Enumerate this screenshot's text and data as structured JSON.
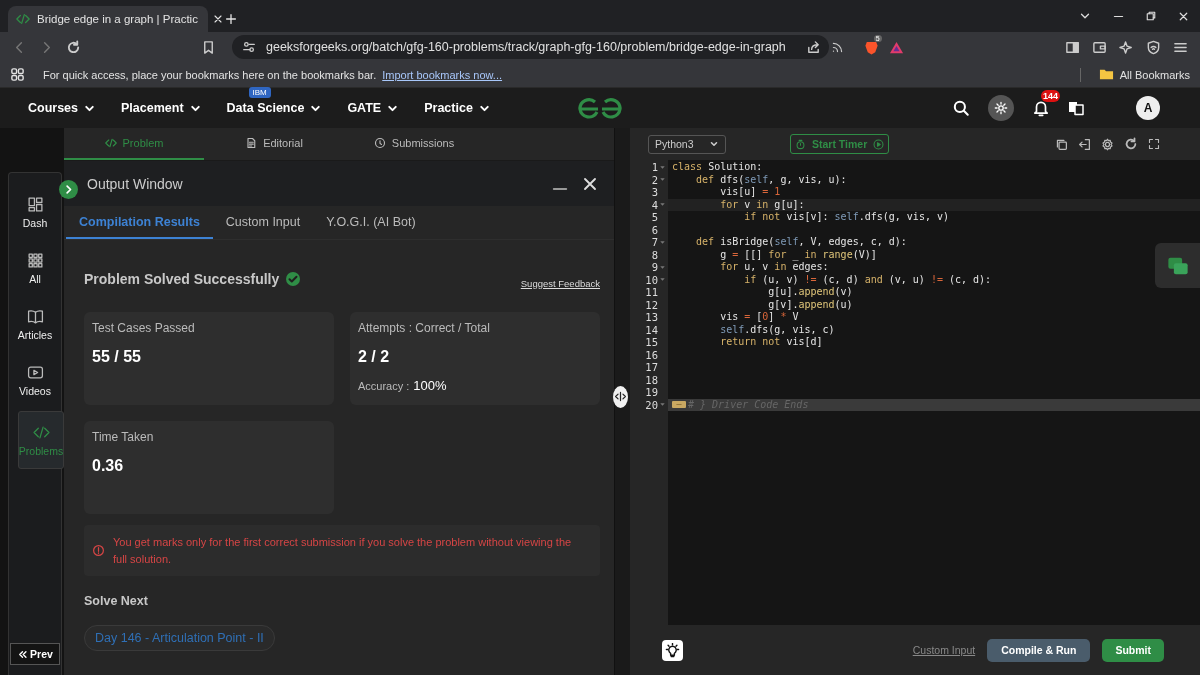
{
  "browser": {
    "tab_title": "Bridge edge in a graph | Practic",
    "url": "geeksforgeeks.org/batch/gfg-160-problems/track/graph-gfg-160/problem/bridge-edge-in-graph",
    "shields_count": "5",
    "bookmarks_hint": "For quick access, place your bookmarks here on the bookmarks bar.",
    "import_link": "Import bookmarks now...",
    "all_bookmarks": "All Bookmarks"
  },
  "header": {
    "nav": [
      {
        "label": "Courses"
      },
      {
        "label": "Placement"
      },
      {
        "label": "Data Science",
        "badge": "IBM"
      },
      {
        "label": "GATE"
      },
      {
        "label": "Practice"
      }
    ],
    "notifications": "144",
    "avatar": "A"
  },
  "problem_tabs": [
    {
      "label": "Problem",
      "kind": "code",
      "selected": true
    },
    {
      "label": "Editorial",
      "kind": "doc",
      "selected": false
    },
    {
      "label": "Submissions",
      "kind": "clock",
      "selected": false
    }
  ],
  "sidebar": {
    "items": [
      {
        "label": "Dash",
        "kind": "dash",
        "selected": false
      },
      {
        "label": "All",
        "kind": "all",
        "selected": false
      },
      {
        "label": "Articles",
        "kind": "articles",
        "selected": false
      },
      {
        "label": "Videos",
        "kind": "videos",
        "selected": false
      },
      {
        "label": "Problems",
        "kind": "problems",
        "selected": true
      }
    ],
    "prev": "Prev"
  },
  "output_window": {
    "title": "Output Window",
    "tabs": [
      {
        "label": "Compilation Results",
        "selected": true
      },
      {
        "label": "Custom Input",
        "selected": false
      },
      {
        "label": "Y.O.G.I. (AI Bot)",
        "selected": false
      }
    ],
    "status": "Problem Solved Successfully",
    "feedback": "Suggest Feedback",
    "cards": [
      {
        "label": "Test Cases Passed",
        "value": "55 / 55"
      },
      {
        "label": "Attempts : Correct / Total",
        "value": "2 / 2",
        "note_label": "Accuracy :",
        "note_value": "100%"
      },
      {
        "label": "Time Taken",
        "value": "0.36"
      }
    ],
    "warning": "You get marks only for the first correct submission if you solve the problem without viewing the full solution.",
    "solve_next": "Solve Next",
    "next_problem": "Day 146 - Articulation Point - II"
  },
  "editor": {
    "language": "Python3",
    "timer": "Start Timer",
    "lines": [
      {
        "number": "1",
        "kind": "code",
        "selected": false,
        "foldable": true,
        "tokens": [
          {
            "kind": "kw",
            "text": "class"
          },
          {
            "kind": "t",
            "text": " Solution:"
          }
        ]
      },
      {
        "number": "2",
        "kind": "code",
        "selected": false,
        "foldable": true,
        "tokens": [
          {
            "kind": "kw",
            "text": "    def"
          },
          {
            "kind": "t",
            "text": " dfs("
          },
          {
            "kind": "self",
            "text": "self"
          },
          {
            "kind": "t",
            "text": ", g, vis, u):"
          }
        ]
      },
      {
        "number": "3",
        "kind": "code",
        "selected": false,
        "foldable": false,
        "tokens": [
          {
            "kind": "t",
            "text": "        vis[u] "
          },
          {
            "kind": "op",
            "text": "="
          },
          {
            "kind": "num",
            "text": " 1"
          }
        ]
      },
      {
        "number": "4",
        "kind": "code",
        "selected": true,
        "foldable": true,
        "tokens": [
          {
            "kind": "kw",
            "text": "        for"
          },
          {
            "kind": "t",
            "text": " v "
          },
          {
            "kind": "kw",
            "text": "in"
          },
          {
            "kind": "t",
            "text": " g[u]:"
          }
        ]
      },
      {
        "number": "5",
        "kind": "code",
        "selected": false,
        "foldable": false,
        "tokens": [
          {
            "kind": "kw",
            "text": "            if"
          },
          {
            "kind": "kw",
            "text": " not"
          },
          {
            "kind": "t",
            "text": " vis[v]: "
          },
          {
            "kind": "self",
            "text": "self"
          },
          {
            "kind": "t",
            "text": ".dfs(g, vis, v)"
          }
        ]
      },
      {
        "number": "6",
        "kind": "code",
        "selected": false,
        "foldable": false
      },
      {
        "number": "7",
        "kind": "code",
        "selected": false,
        "foldable": true,
        "tokens": [
          {
            "kind": "kw",
            "text": "    def"
          },
          {
            "kind": "t",
            "text": " isBridge("
          },
          {
            "kind": "self",
            "text": "self"
          },
          {
            "kind": "t",
            "text": ", V, edges, c, d):"
          }
        ]
      },
      {
        "number": "8",
        "kind": "code",
        "selected": false,
        "foldable": false,
        "tokens": [
          {
            "kind": "t",
            "text": "        g "
          },
          {
            "kind": "op",
            "text": "="
          },
          {
            "kind": "t",
            "text": " [[] "
          },
          {
            "kind": "kw",
            "text": "for"
          },
          {
            "kind": "t",
            "text": " _ "
          },
          {
            "kind": "kw",
            "text": "in"
          },
          {
            "kind": "fn",
            "text": " range"
          },
          {
            "kind": "t",
            "text": "(V)]"
          }
        ]
      },
      {
        "number": "9",
        "kind": "code",
        "selected": false,
        "foldable": true,
        "tokens": [
          {
            "kind": "kw",
            "text": "        for"
          },
          {
            "kind": "t",
            "text": " u, v "
          },
          {
            "kind": "kw",
            "text": "in"
          },
          {
            "kind": "t",
            "text": " edges:"
          }
        ]
      },
      {
        "number": "10",
        "kind": "code",
        "selected": false,
        "foldable": true,
        "tokens": [
          {
            "kind": "kw",
            "text": "            if"
          },
          {
            "kind": "t",
            "text": " (u, v) "
          },
          {
            "kind": "op",
            "text": "!="
          },
          {
            "kind": "t",
            "text": " (c, d) "
          },
          {
            "kind": "kw",
            "text": "and"
          },
          {
            "kind": "t",
            "text": " (v, u) "
          },
          {
            "kind": "op",
            "text": "!="
          },
          {
            "kind": "t",
            "text": " (c, d):"
          }
        ]
      },
      {
        "number": "11",
        "kind": "code",
        "selected": false,
        "foldable": false,
        "tokens": [
          {
            "kind": "t",
            "text": "                g[u]."
          },
          {
            "kind": "fn",
            "text": "append"
          },
          {
            "kind": "t",
            "text": "(v)"
          }
        ]
      },
      {
        "number": "12",
        "kind": "code",
        "selected": false,
        "foldable": false,
        "tokens": [
          {
            "kind": "t",
            "text": "                g[v]."
          },
          {
            "kind": "fn",
            "text": "append"
          },
          {
            "kind": "t",
            "text": "(u)"
          }
        ]
      },
      {
        "number": "13",
        "kind": "code",
        "selected": false,
        "foldable": false,
        "tokens": [
          {
            "kind": "t",
            "text": "        vis "
          },
          {
            "kind": "op",
            "text": "="
          },
          {
            "kind": "t",
            "text": " ["
          },
          {
            "kind": "num",
            "text": "0"
          },
          {
            "kind": "t",
            "text": "] "
          },
          {
            "kind": "op",
            "text": "*"
          },
          {
            "kind": "t",
            "text": " V"
          }
        ]
      },
      {
        "number": "14",
        "kind": "code",
        "selected": false,
        "foldable": false,
        "tokens": [
          {
            "kind": "self",
            "text": "        self"
          },
          {
            "kind": "t",
            "text": ".dfs(g, vis, c)"
          }
        ]
      },
      {
        "number": "15",
        "kind": "code",
        "selected": false,
        "foldable": false,
        "tokens": [
          {
            "kind": "kw",
            "text": "        return"
          },
          {
            "kind": "kw",
            "text": " not"
          },
          {
            "kind": "t",
            "text": " vis[d]"
          }
        ]
      },
      {
        "number": "16",
        "kind": "code",
        "selected": false,
        "foldable": false
      },
      {
        "number": "17",
        "kind": "code",
        "selected": false,
        "foldable": false
      },
      {
        "number": "18",
        "kind": "code",
        "selected": false,
        "foldable": false
      },
      {
        "number": "19",
        "kind": "code",
        "selected": false,
        "foldable": false
      },
      {
        "number": "20",
        "kind": "folded",
        "selected": false,
        "foldable": true,
        "tokens": [
          {
            "kind": "cm",
            "text": "# } Driver Code Ends"
          }
        ]
      }
    ],
    "custom_input": "Custom Input",
    "compile": "Compile & Run",
    "submit": "Submit"
  }
}
